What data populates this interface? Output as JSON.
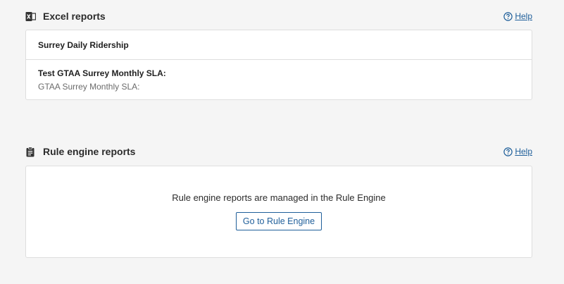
{
  "excel": {
    "title": "Excel reports",
    "help_label": "Help",
    "reports": [
      {
        "name": "Surrey Daily Ridership",
        "description": ""
      },
      {
        "name": "Test GTAA Surrey Monthly SLA:",
        "description": "GTAA Surrey Monthly SLA:"
      }
    ]
  },
  "rule_engine": {
    "title": "Rule engine reports",
    "help_label": "Help",
    "message": "Rule engine reports are managed in the Rule Engine",
    "button_label": "Go to Rule Engine"
  },
  "colors": {
    "accent": "#1f5f9a",
    "border": "#dedede",
    "background": "#f5f5f5"
  }
}
